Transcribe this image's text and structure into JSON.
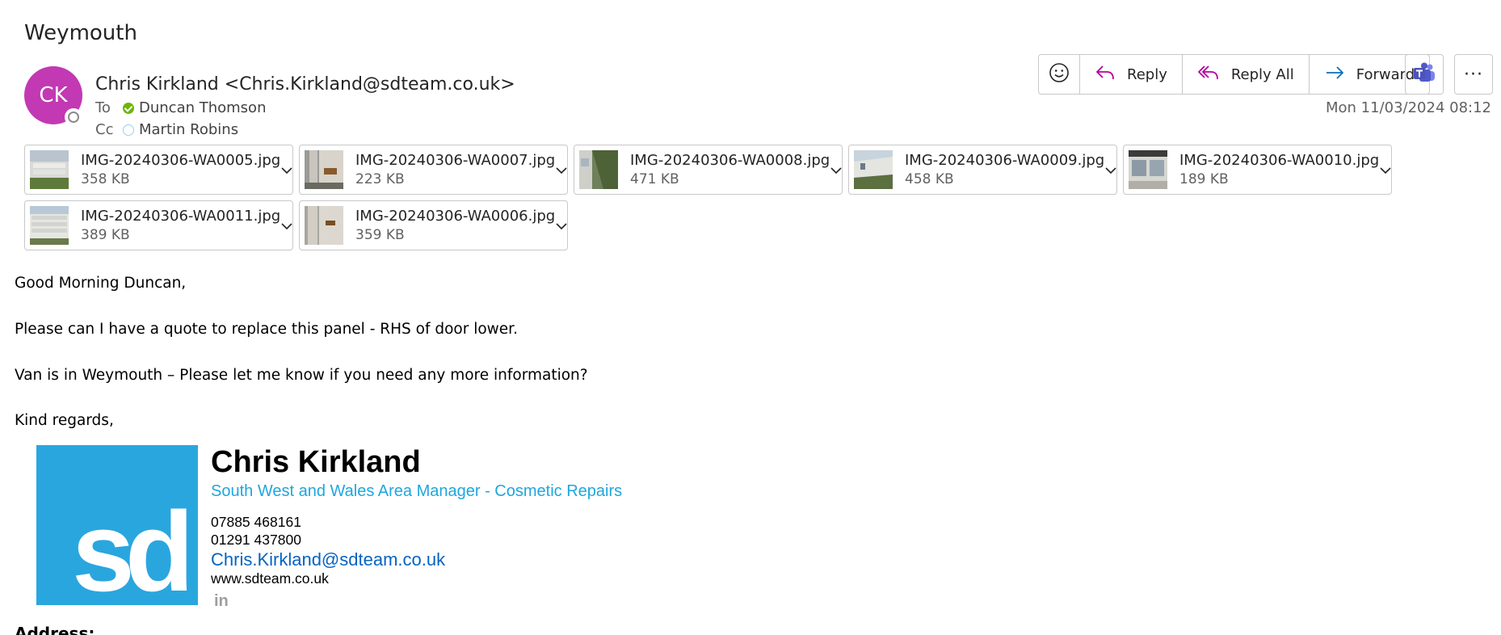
{
  "subject": "Weymouth",
  "sender": {
    "initials": "CK",
    "display": "Chris Kirkland <Chris.Kirkland@sdteam.co.uk>",
    "avatar_color": "#c239b3"
  },
  "recipients": {
    "to_label": "To",
    "to_name": "Duncan Thomson",
    "cc_label": "Cc",
    "cc_name": "Martin Robins"
  },
  "toolbar": {
    "reply": "Reply",
    "reply_all": "Reply All",
    "forward": "Forward",
    "more": "···",
    "accent": "#b4009e"
  },
  "timestamp": "Mon 11/03/2024 08:12",
  "attachments": [
    {
      "name": "IMG-20240306-WA0005.jpg",
      "size": "358 KB"
    },
    {
      "name": "IMG-20240306-WA0007.jpg",
      "size": "223 KB"
    },
    {
      "name": "IMG-20240306-WA0008.jpg",
      "size": "471 KB"
    },
    {
      "name": "IMG-20240306-WA0009.jpg",
      "size": "458 KB"
    },
    {
      "name": "IMG-20240306-WA0010.jpg",
      "size": "189 KB"
    },
    {
      "name": "IMG-20240306-WA0011.jpg",
      "size": "389 KB"
    },
    {
      "name": "IMG-20240306-WA0006.jpg",
      "size": "359 KB"
    }
  ],
  "body": {
    "greeting": "Good Morning Duncan,",
    "line1": "Please can I have a quote to replace this panel -  RHS of door lower.",
    "line2": "Van is in Weymouth – Please let me know if you need any more information?",
    "closing": "Kind regards,"
  },
  "signature": {
    "name": "Chris Kirkland",
    "title": "South West and Wales Area Manager - Cosmetic Repairs",
    "phone1": "07885 468161",
    "phone2": "01291 437800",
    "email": "Chris.Kirkland@sdteam.co.uk",
    "website": "www.sdteam.co.uk",
    "logo_text": "sd",
    "linkedin": "in",
    "address_label": "Address:"
  }
}
